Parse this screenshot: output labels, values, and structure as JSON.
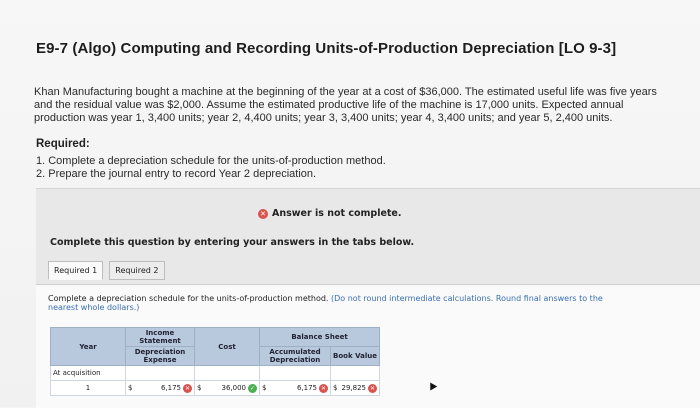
{
  "title": "E9-7 (Algo) Computing and Recording Units-of-Production Depreciation [LO 9-3]",
  "problem_text": "Khan Manufacturing bought a machine at the beginning of the year at a cost of $36,000. The estimated useful life was five years and the residual value was $2,000. Assume the estimated productive life of the machine is 17,000 units. Expected annual production was year 1, 3,400 units; year 2, 4,400 units; year 3, 3,400 units; year 4, 3,400 units; and year 5, 2,400 units.",
  "required_heading": "Required:",
  "requirements": [
    "1. Complete a depreciation schedule for the units-of-production method.",
    "2. Prepare the journal entry to record Year 2 depreciation."
  ],
  "status": {
    "text": "Answer is not complete.",
    "icon": "x-circle-icon",
    "color": "#d9534f"
  },
  "instruction": "Complete this question by entering your answers in the tabs below.",
  "tabs": [
    {
      "label": "Required 1",
      "active": true
    },
    {
      "label": "Required 2",
      "active": false
    }
  ],
  "directions": {
    "main": "Complete a depreciation schedule for the units-of-production method.",
    "note": "(Do not round intermediate calculations. Round final answers to the nearest whole dollars.)"
  },
  "table": {
    "headers": {
      "year": "Year",
      "income_statement": "Income Statement",
      "depreciation_expense": "Depreciation Expense",
      "cost": "Cost",
      "balance_sheet": "Balance Sheet",
      "accumulated_depreciation": "Accumulated Depreciation",
      "book_value": "Book Value"
    },
    "rows": [
      {
        "year": "At acquisition",
        "dep_exp": "",
        "cost": "",
        "accum": "",
        "book": ""
      },
      {
        "year": "1",
        "dep_exp": "6,175",
        "dep_exp_status": "incorrect",
        "cost": "36,000",
        "cost_status": "correct",
        "accum": "6,175",
        "accum_status": "incorrect",
        "book": "29,825",
        "book_status": "incorrect",
        "currency": "$"
      }
    ]
  },
  "colors": {
    "header_bg": "#b8c9dd",
    "correct": "#4caf50",
    "incorrect": "#d9534f"
  }
}
